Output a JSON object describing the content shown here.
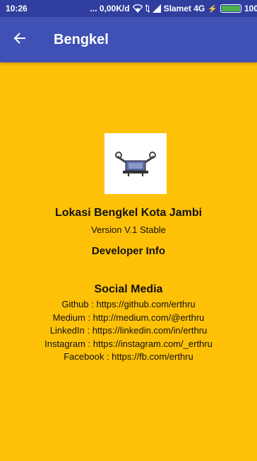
{
  "status_bar": {
    "time": "10:26",
    "network_speed": "... 0,00K/d",
    "carrier": "Slamet 4G",
    "battery": "100"
  },
  "app_bar": {
    "back_icon": "arrow-back-icon",
    "title": "Bengkel"
  },
  "about": {
    "logo": "bengkel-logo",
    "app_name": "Lokasi Bengkel Kota Jambi",
    "version": "Version V.1 Stable",
    "developer_heading": "Developer Info",
    "social_heading": "Social Media",
    "social_links": [
      "Github : https://github.com/erthru",
      "Medium : http://medium.com/@erthru",
      "LinkedIn : https://linkedin.com/in/erthru",
      "Instagram : https://instagram.com/_erthru",
      "Facebook : https://fb.com/erthru"
    ]
  },
  "colors": {
    "status_bar": "#303F9F",
    "app_bar": "#3F51B5",
    "background": "#FFC107"
  }
}
